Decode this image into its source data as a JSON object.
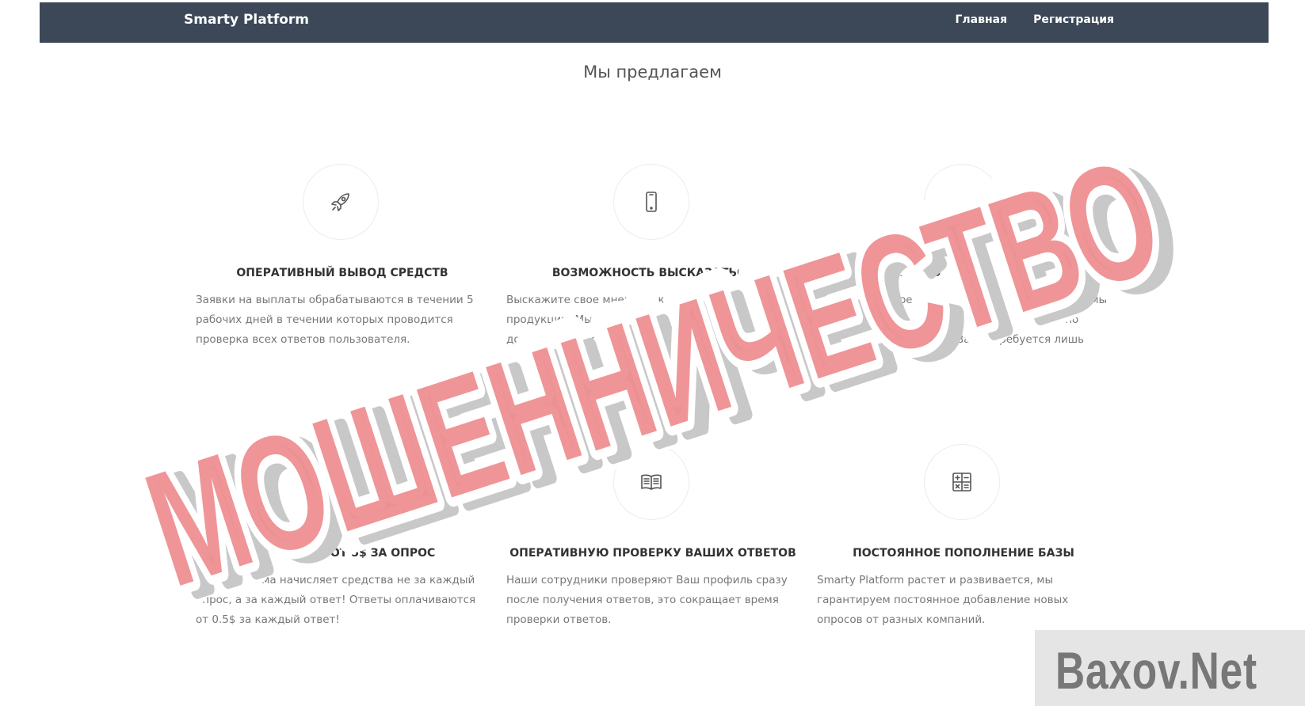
{
  "navbar": {
    "brand": "Smarty Platform",
    "links": [
      "Главная",
      "Регистрация"
    ],
    "bg_color": "#3c4858"
  },
  "section_title": "Мы предлагаем",
  "features": [
    {
      "icon": "rocket-icon",
      "title": "ОПЕРАТИВНЫЙ ВЫВОД СРЕДСТВ",
      "text": "Заявки на выплаты обрабатываются в течении 5 рабочих дней в течении которых проводится проверка всех ответов пользователя."
    },
    {
      "icon": "smartphone-icon",
      "title": "ВОЗМОЖНОСТЬ ВЫСКАЗАТЬСЯ",
      "text": "Выскажите свое мнение о каком то бренде и его продукции. Мы считаем что каждый человек должен быть услышан!"
    },
    {
      "icon": "clock-icon",
      "title": "ЭКОНОМИЮ ВАШЕГО ВРЕМЕНИ",
      "text": "Благодаря современным технологиям анализа, мы сделали прохождение вопросов максимально быстрым и удобным. От Вас потребуется лишь заполнить анкету."
    },
    {
      "icon": "trend-line-icon",
      "title": "ЗАРАБОТОК ОТ 5$ ЗА ОПРОС",
      "text": "Наша система начисляет средства не за каждый опрос, а за каждый ответ! Ответы оплачиваются от 0.5$ за каждый ответ!"
    },
    {
      "icon": "open-book-icon",
      "title": "ОПЕРАТИВНУЮ ПРОВЕРКУ ВАШИХ ОТВЕТОВ",
      "text": "Наши сотрудники проверяют Ваш профиль сразу после получения ответов, это сокращает время проверки ответов."
    },
    {
      "icon": "calculator-icon",
      "title": "ПОСТОЯННОЕ ПОПОЛНЕНИЕ БАЗЫ",
      "text": "Smarty Platform растет и развивается, мы гарантируем постоянное добавление новых опросов от разных компаний."
    }
  ],
  "stamp": {
    "text": "МОШЕННИЧЕСТВО",
    "fill_color": "#ee8c8e",
    "shadow_color": "#c8c8c8"
  },
  "watermark": "Baxov.Net"
}
